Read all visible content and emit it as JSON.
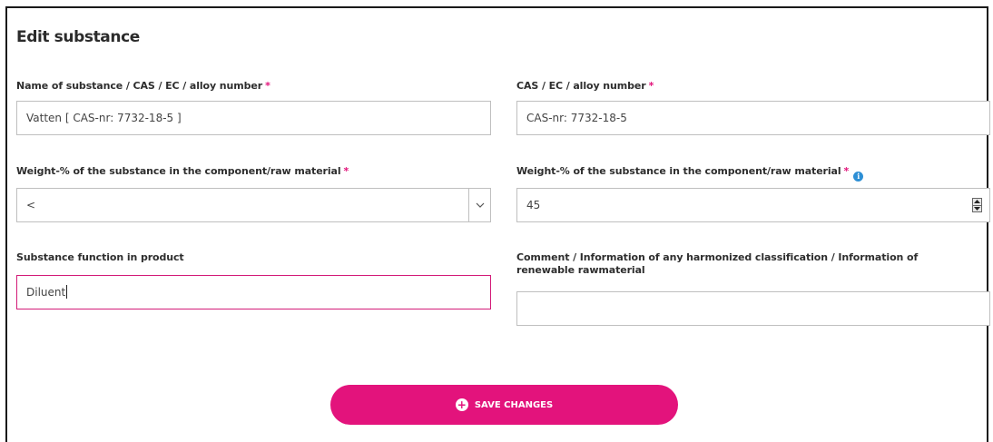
{
  "form": {
    "title": "Edit substance",
    "required_mark": "*",
    "substance_name": {
      "label": "Name of substance / CAS / EC / alloy number",
      "value": "Vatten [ CAS-nr: 7732-18-5 ]"
    },
    "cas_number": {
      "label": "CAS / EC / alloy number",
      "value": "CAS-nr: 7732-18-5"
    },
    "weight_operator": {
      "label": "Weight-% of the substance in the component/raw material",
      "selected": "<"
    },
    "weight_value": {
      "label": "Weight-% of the substance in the component/raw material",
      "value": "45",
      "info_icon": "i"
    },
    "substance_function": {
      "label": "Substance function in product",
      "value": "Diluent"
    },
    "comment": {
      "label_line1": "Comment / Information of any harmonized classification / Information of",
      "label_line2": "renewable rawmaterial",
      "value": ""
    },
    "save_button": {
      "label": "SAVE CHANGES",
      "icon_glyph": "+"
    }
  },
  "colors": {
    "accent": "#e3137c",
    "focus_border": "#d31b78",
    "info": "#2d8fd5"
  },
  "icons": {
    "info": "info-icon",
    "chevron": "chevron-down-icon",
    "spinner_up": "caret-up-icon",
    "spinner_down": "caret-down-icon",
    "save": "plus-circle-icon"
  }
}
